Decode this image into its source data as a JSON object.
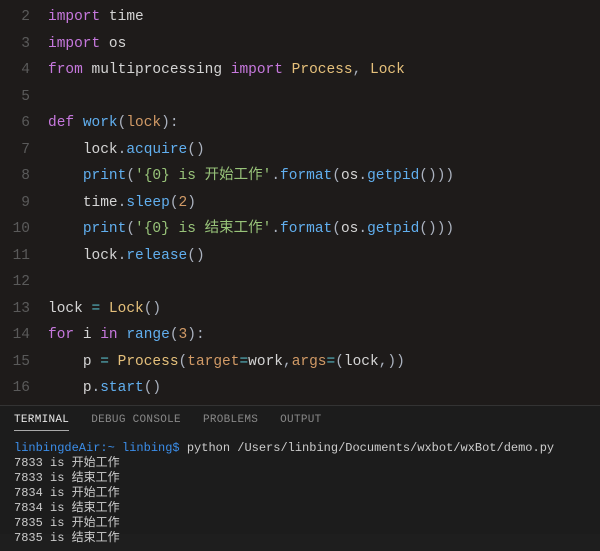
{
  "code": {
    "lines": [
      {
        "n": 2,
        "tokens": [
          [
            "kw-import",
            "import "
          ],
          [
            "mod",
            "time"
          ]
        ]
      },
      {
        "n": 3,
        "tokens": [
          [
            "kw-import",
            "import "
          ],
          [
            "mod",
            "os"
          ]
        ]
      },
      {
        "n": 4,
        "tokens": [
          [
            "kw-from",
            "from "
          ],
          [
            "mod",
            "multiprocessing "
          ],
          [
            "kw-import",
            "import "
          ],
          [
            "cls",
            "Process"
          ],
          [
            "punct",
            ", "
          ],
          [
            "cls",
            "Lock"
          ]
        ]
      },
      {
        "n": 5,
        "tokens": []
      },
      {
        "n": 6,
        "tokens": [
          [
            "kw-def",
            "def "
          ],
          [
            "fn-def",
            "work"
          ],
          [
            "punct",
            "("
          ],
          [
            "param",
            "lock"
          ],
          [
            "punct",
            "):"
          ]
        ]
      },
      {
        "n": 7,
        "indent": 1,
        "tokens": [
          [
            "var",
            "lock"
          ],
          [
            "punct",
            "."
          ],
          [
            "fn",
            "acquire"
          ],
          [
            "punct",
            "()"
          ]
        ]
      },
      {
        "n": 8,
        "indent": 1,
        "tokens": [
          [
            "fn",
            "print"
          ],
          [
            "punct",
            "("
          ],
          [
            "str",
            "'{0} is 开始工作'"
          ],
          [
            "punct",
            "."
          ],
          [
            "fn",
            "format"
          ],
          [
            "punct",
            "("
          ],
          [
            "var",
            "os"
          ],
          [
            "punct",
            "."
          ],
          [
            "fn",
            "getpid"
          ],
          [
            "punct",
            "()))"
          ]
        ]
      },
      {
        "n": 9,
        "indent": 1,
        "tokens": [
          [
            "var",
            "time"
          ],
          [
            "punct",
            "."
          ],
          [
            "fn",
            "sleep"
          ],
          [
            "punct",
            "("
          ],
          [
            "num",
            "2"
          ],
          [
            "punct",
            ")"
          ]
        ]
      },
      {
        "n": 10,
        "indent": 1,
        "tokens": [
          [
            "fn",
            "print"
          ],
          [
            "punct",
            "("
          ],
          [
            "str",
            "'{0} is 结束工作'"
          ],
          [
            "punct",
            "."
          ],
          [
            "fn",
            "format"
          ],
          [
            "punct",
            "("
          ],
          [
            "var",
            "os"
          ],
          [
            "punct",
            "."
          ],
          [
            "fn",
            "getpid"
          ],
          [
            "punct",
            "()))"
          ]
        ]
      },
      {
        "n": 11,
        "indent": 1,
        "tokens": [
          [
            "var",
            "lock"
          ],
          [
            "punct",
            "."
          ],
          [
            "fn",
            "release"
          ],
          [
            "punct",
            "()"
          ]
        ]
      },
      {
        "n": 12,
        "tokens": []
      },
      {
        "n": 13,
        "tokens": [
          [
            "var",
            "lock "
          ],
          [
            "op",
            "= "
          ],
          [
            "cls",
            "Lock"
          ],
          [
            "punct",
            "()"
          ]
        ]
      },
      {
        "n": 14,
        "tokens": [
          [
            "kw-for",
            "for "
          ],
          [
            "var",
            "i "
          ],
          [
            "kw-in",
            "in "
          ],
          [
            "fn",
            "range"
          ],
          [
            "punct",
            "("
          ],
          [
            "num",
            "3"
          ],
          [
            "punct",
            "):"
          ]
        ]
      },
      {
        "n": 15,
        "indent": 1,
        "tokens": [
          [
            "var",
            "p "
          ],
          [
            "op",
            "= "
          ],
          [
            "cls",
            "Process"
          ],
          [
            "punct",
            "("
          ],
          [
            "param",
            "target"
          ],
          [
            "op",
            "="
          ],
          [
            "var",
            "work"
          ],
          [
            "punct",
            ","
          ],
          [
            "param",
            "args"
          ],
          [
            "op",
            "="
          ],
          [
            "punct",
            "("
          ],
          [
            "var",
            "lock"
          ],
          [
            "punct",
            ",))"
          ]
        ]
      },
      {
        "n": 16,
        "indent": 1,
        "tokens": [
          [
            "var",
            "p"
          ],
          [
            "punct",
            "."
          ],
          [
            "fn",
            "start"
          ],
          [
            "punct",
            "()"
          ]
        ]
      }
    ]
  },
  "panel": {
    "tabs": [
      "TERMINAL",
      "DEBUG CONSOLE",
      "PROBLEMS",
      "OUTPUT"
    ],
    "active_tab": 0,
    "prompt_host": "linbingdeAir:~ linbing$",
    "command": " python /Users/linbing/Documents/wxbot/wxBot/demo.py",
    "output": [
      "7833 is 开始工作",
      "7833 is 结束工作",
      "7834 is 开始工作",
      "7834 is 结束工作",
      "7835 is 开始工作",
      "7835 is 结束工作"
    ]
  }
}
